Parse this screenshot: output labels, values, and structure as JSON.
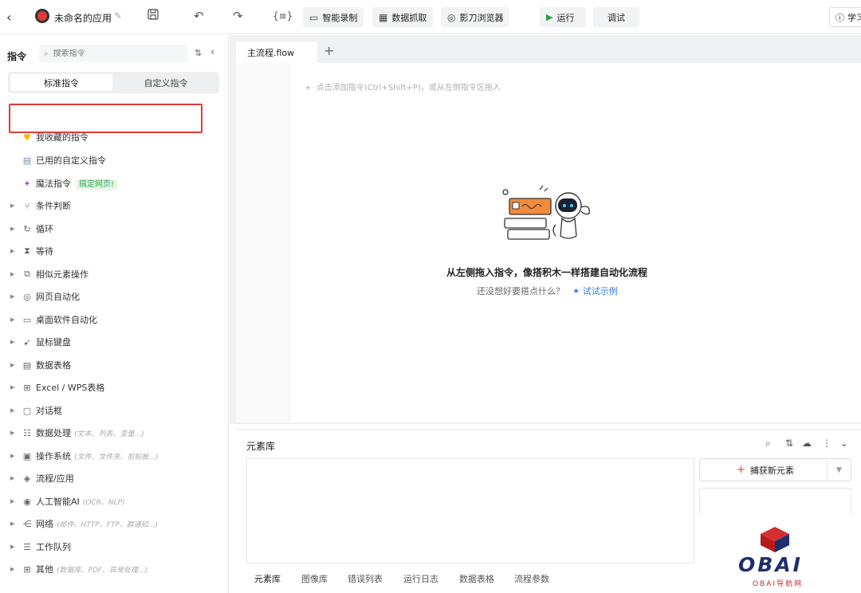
{
  "toolbar": {
    "app_name": "未命名的应用",
    "record_label": "智能录制",
    "scrape_label": "数据抓取",
    "browser_label": "影刀浏览器",
    "run_label": "运行",
    "debug_label": "调试",
    "learn_label": "学习",
    "icons": [
      "back-arrow",
      "edit-pencil",
      "save",
      "undo",
      "redo",
      "variable-braces",
      "camera",
      "table",
      "browser",
      "play",
      "help-circle"
    ]
  },
  "sidebar": {
    "title": "指令",
    "search_placeholder": "搜索指令",
    "tabs": [
      {
        "label": "标准指令",
        "active": true
      },
      {
        "label": "自定义指令",
        "active": false
      }
    ],
    "favorites_label": "我收藏的指令",
    "used_custom_label": "已用的自定义指令",
    "magic_label": "魔法指令",
    "magic_tag": "搞定网页!",
    "items": [
      {
        "label": "条件判断",
        "hint": ""
      },
      {
        "label": "循环",
        "hint": ""
      },
      {
        "label": "等待",
        "hint": ""
      },
      {
        "label": "相似元素操作",
        "hint": ""
      },
      {
        "label": "网页自动化",
        "hint": ""
      },
      {
        "label": "桌面软件自动化",
        "hint": ""
      },
      {
        "label": "鼠标键盘",
        "hint": ""
      },
      {
        "label": "数据表格",
        "hint": ""
      },
      {
        "label": "Excel / WPS表格",
        "hint": ""
      },
      {
        "label": "对话框",
        "hint": ""
      },
      {
        "label": "数据处理",
        "hint": "(文本、列表、变量...)"
      },
      {
        "label": "操作系统",
        "hint": "(文件、文件夹、剪贴板...)"
      },
      {
        "label": "流程/应用",
        "hint": ""
      },
      {
        "label": "人工智能AI",
        "hint": "(OCR、NLP)"
      },
      {
        "label": "网络",
        "hint": "(邮件、HTTP、FTP、群通知...)"
      },
      {
        "label": "工作队列",
        "hint": ""
      },
      {
        "label": "其他",
        "hint": "(数据库、PDF、异常处理...)"
      }
    ]
  },
  "editor": {
    "file_tab": "主流程.flow",
    "hint": "点击添加指令(Ctrl+Shift+P)，或从左侧指令区拖入",
    "empty_title": "从左侧拖入指令，像搭积木一样搭建自动化流程",
    "empty_sub": "还没想好要搭点什么？",
    "try_link": "试试示例"
  },
  "library": {
    "title": "元素库",
    "capture_label": "捕获新元素",
    "bottom_tabs": [
      "元素库",
      "图像库",
      "错误列表",
      "运行日志",
      "数据表格",
      "流程参数"
    ]
  },
  "watermark": {
    "text": "OBAI",
    "sub": "OBAI导航网"
  }
}
